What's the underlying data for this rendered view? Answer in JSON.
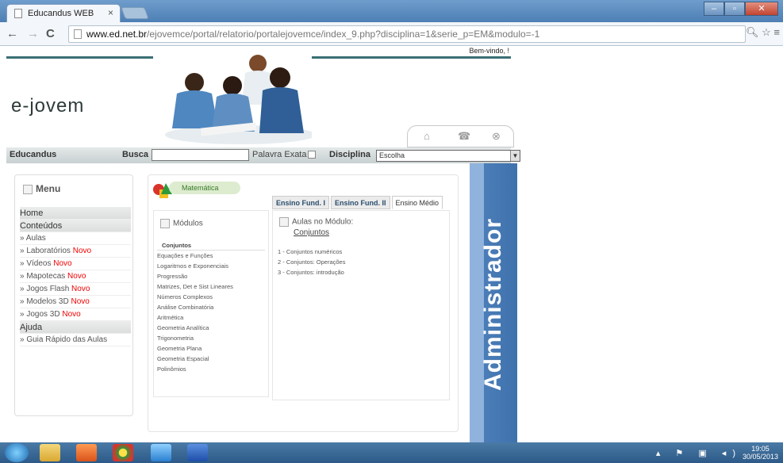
{
  "browser": {
    "tab_title": "Educandus WEB",
    "tab_close": "×",
    "url_domain": "www.ed.net.br",
    "url_path": "/ejovemce/portal/relatorio/portalejovemce/index_9.php?disciplina=1&serie_p=EM&modulo=-1"
  },
  "header": {
    "welcome": "Bem-vindo, !",
    "logo": "e-jovem"
  },
  "searchbar": {
    "site_label": "Educandus",
    "search_label": "Busca",
    "exact_label": "Palavra Exata",
    "discipline_label": "Disciplina",
    "discipline_value": "Escolha"
  },
  "menu": {
    "title": "Menu",
    "items": [
      {
        "label": "Home",
        "section": true,
        "novo": ""
      },
      {
        "label": "Conteúdos",
        "section": true,
        "novo": ""
      },
      {
        "label": "» Aulas",
        "section": false,
        "novo": ""
      },
      {
        "label": "» Laboratórios ",
        "section": false,
        "novo": "Novo"
      },
      {
        "label": "» Vídeos ",
        "section": false,
        "novo": "Novo"
      },
      {
        "label": "» Mapotecas ",
        "section": false,
        "novo": "Novo"
      },
      {
        "label": "» Jogos Flash ",
        "section": false,
        "novo": "Novo"
      },
      {
        "label": "» Modelos 3D ",
        "section": false,
        "novo": "Novo"
      },
      {
        "label": "» Jogos 3D ",
        "section": false,
        "novo": "Novo"
      },
      {
        "label": "Ajuda",
        "section": true,
        "novo": ""
      },
      {
        "label": "» Guia Rápido das Aulas",
        "section": false,
        "novo": ""
      }
    ]
  },
  "content": {
    "subject": "Matemática",
    "tabs": [
      "Ensino Fund. I",
      "Ensino Fund. II",
      "Ensino Médio"
    ],
    "modules_title": "Módulos",
    "modules": [
      "Conjuntos",
      "Equações e Funções",
      "Logaritmos e Exponenciais",
      "Progressão",
      "Matrizes, Det e Sist Lineares",
      "Números Complexos",
      "Análise Combinatória",
      "Aritmética",
      "Geometria Analítica",
      "Trigonometria",
      "Geometria Plana",
      "Geometria Espacial",
      "Polinômios"
    ],
    "aulas_title": "Aulas no Módulo:",
    "aulas_module": "Conjuntos",
    "aulas": [
      "1 - Conjuntos numéricos",
      "2 - Conjuntos: Operações",
      "3 - Conjuntos: introdução"
    ]
  },
  "admin_label": "Administrador",
  "taskbar": {
    "time": "19:05",
    "date": "30/05/2013"
  },
  "colors": {
    "admin_bar": "#3f72ad",
    "novo": "#e00000",
    "top_rule": "#3a6f74"
  }
}
